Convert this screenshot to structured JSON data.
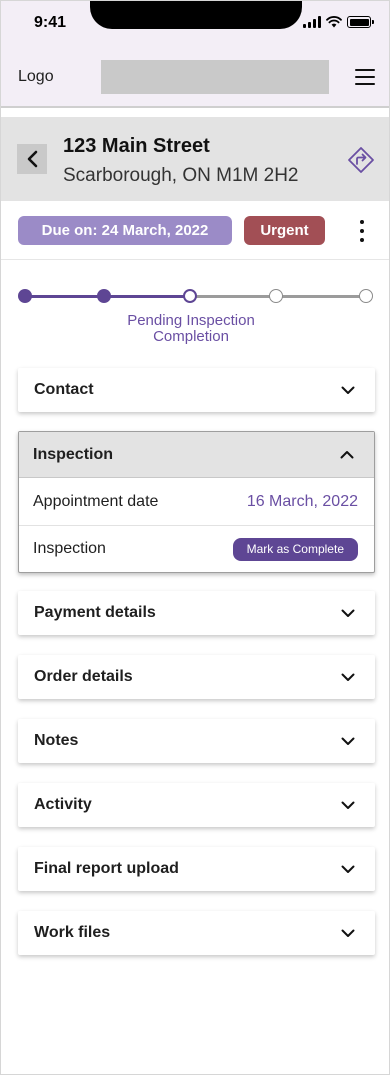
{
  "status_bar": {
    "time": "9:41"
  },
  "app_bar": {
    "logo": "Logo"
  },
  "address": {
    "line1": "123 Main Street",
    "line2": "Scarborough, ON M1M 2H2"
  },
  "due": {
    "label": "Due on: 24 March, 2022",
    "priority": "Urgent"
  },
  "progress": {
    "steps_total": 5,
    "steps_completed": 2,
    "current_step": 3,
    "current_label": "Pending Inspection Completion"
  },
  "sections": {
    "contact": "Contact",
    "inspection": {
      "title": "Inspection",
      "appointment_label": "Appointment date",
      "appointment_value": "16 March, 2022",
      "inspection_label": "Inspection",
      "complete_button": "Mark as Complete"
    },
    "payment": "Payment details",
    "order": "Order details",
    "notes": "Notes",
    "activity": "Activity",
    "final_report": "Final report upload",
    "work_files": "Work files"
  },
  "colors": {
    "accent": "#5e4694",
    "due_badge": "#9b8bc7",
    "urgent_badge": "#a24f55",
    "app_bar_bg": "#f3eef6"
  },
  "icons": {
    "back": "chevron-left-icon",
    "directions": "directions-icon",
    "menu": "hamburger-menu-icon",
    "more": "vertical-dots-icon",
    "expand": "chevron-down-icon",
    "collapse": "chevron-up-icon"
  }
}
